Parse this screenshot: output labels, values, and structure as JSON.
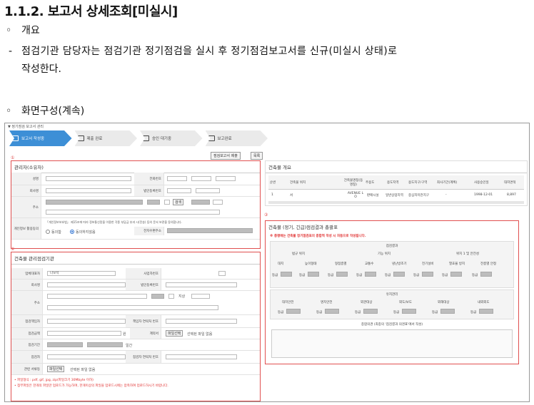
{
  "heading": "1.1.2. 보고서 상세조회[미실시]",
  "overview": {
    "bullet": "◦",
    "title": "개요"
  },
  "desc": {
    "dash": "-",
    "line1": "점검기관 담당자는 점검기관 정기점검을 실시 후 정기점검보고서를 신규(미실시 상태)로",
    "line2": "작성한다."
  },
  "screen": {
    "bullet": "◦",
    "title": "화면구성(계속)"
  },
  "shot": {
    "crumb": "▼ 정기점검 보고서 관리",
    "steps": [
      "보고서 작성중",
      "제출 완료",
      "승인 대기중",
      "보고완료"
    ],
    "btn_submit": "점검보고서 제출",
    "btn_list": "목록",
    "owner": {
      "num": "①",
      "title": "관리자(소유자)",
      "name": "성명",
      "phone": "전화번호",
      "org": "회사명",
      "bizno": "법인등록번호",
      "addr": "주소",
      "search": "검색",
      "consent_label": "개인정보 활용동의",
      "consent_text": "「개인정보보호법」 제15조에 따라 정보통신망을 이용한 각종 부담금 부과 시(전송) 등의 문서 보관을 동의합니다.",
      "agree": "동의함",
      "disagree": "동의하지않음",
      "email": "전자우편주소"
    },
    "building": {
      "title": "건축물 개요",
      "cols": [
        "순번",
        "건축물 위치",
        "건축물명칭(동명칭)",
        "주용도",
        "용도지역",
        "용도지구/구역",
        "최사기간(계획)",
        "사용승인일",
        "대지면적"
      ],
      "row": [
        "1",
        "서",
        "AVENUE L O",
        "판매시설",
        "일반상업지역",
        "중심지미관지구",
        "-",
        "1998-12-01",
        "8,897"
      ]
    },
    "agency": {
      "num": "②",
      "title": "건축물 관리점검기관",
      "ceo": "업체대표자",
      "ceo_val": "나보석",
      "bizreg": "사업자번호",
      "company": "회사명",
      "corpno": "법인등록번호",
      "addr": "주소",
      "road": "지상",
      "mgr": "점검책임자",
      "mgr_phone": "책임자 연락처 번호",
      "contract": "점검금액",
      "contract_unit": "원",
      "contract_doc": "계약서",
      "file_btn": "파일선택",
      "no_file": "선택된 파일 없음",
      "period": "점검기간",
      "period_unit": "일간",
      "inspector": "점검자",
      "inspector_phone": "점검자 연락처 번호",
      "attach": "관련 서류등",
      "attach_btn": "파일선택",
      "attach_none": "선택된 파일 없음",
      "note1": "• 파일형식 : pdf, gif, jpg, zip(파일크기 30Mbyte 이하)",
      "note2": "• 첨부파일은 한개의 파일만 업로드가 가능하며, 한개이상의 파일을 업로드시에는 압축하여 업로드하시기 바랍니다."
    },
    "result": {
      "num": "③",
      "title": "건축물 (정기, 긴급)점검결과 총괄표",
      "warn": "※ 총평에는 건축물 정기점검표의 종합적 작성 시 자동으로 작성됩니다.",
      "eval": "점검결과",
      "groups": [
        "법규 위치",
        "기능 위치",
        "위치 1 및 안전성"
      ],
      "items1": [
        "대지",
        "높이형태",
        "형점층별",
        "교통수",
        "냉난방조기",
        "전기설비",
        "열효율 방지",
        "전층별 안정"
      ],
      "grade": "등급",
      "sub": "유지관리",
      "items2": [
        "대치안전",
        "명치안전",
        "외관대상",
        "외도/보도",
        "외해대상",
        "내외외도"
      ],
      "summary": "종합의견 (최종의 '점검결과 의견표'에서 작성)"
    }
  }
}
